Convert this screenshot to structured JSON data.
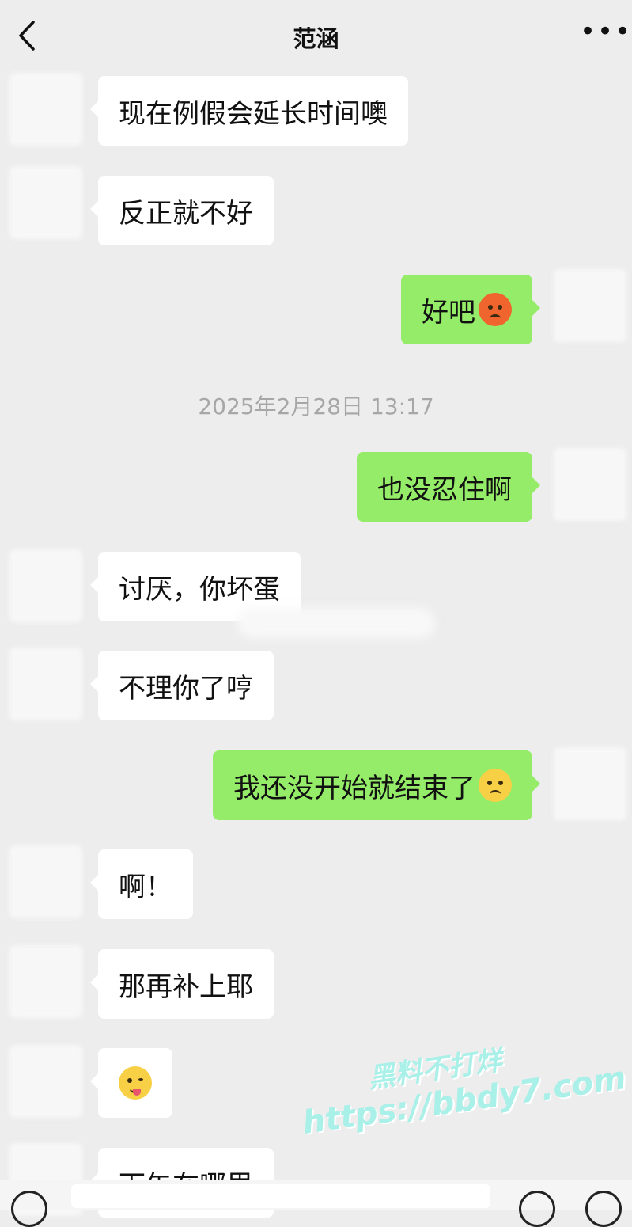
{
  "header": {
    "title": "范涵",
    "more_label": "•••"
  },
  "timestamp": "2025年2月28日 13:17",
  "messages": [
    {
      "side": "in",
      "text": "现在例假会延长时间噢"
    },
    {
      "side": "in",
      "text": "反正就不好"
    },
    {
      "side": "out",
      "text": "好吧",
      "emoji": "angry-face-emoji"
    },
    {
      "side": "out",
      "text": "也没忍住啊"
    },
    {
      "side": "in",
      "text": "讨厌，你坏蛋"
    },
    {
      "side": "in",
      "text": "不理你了哼"
    },
    {
      "side": "out",
      "text": "我还没开始就结束了",
      "emoji": "pleading-face-emoji"
    },
    {
      "side": "in",
      "text": "啊！"
    },
    {
      "side": "in",
      "text": "那再补上耶"
    },
    {
      "side": "in",
      "text": "",
      "emoji": "winking-tongue-emoji"
    },
    {
      "side": "in",
      "text": "下午在哪里"
    }
  ],
  "watermark": {
    "line1": "黑料不打烊",
    "line2": "https://bbdy7.com"
  },
  "colors": {
    "background": "#ededed",
    "incoming_bubble": "#ffffff",
    "outgoing_bubble": "#95ec69",
    "timestamp": "#a7a7a7"
  }
}
